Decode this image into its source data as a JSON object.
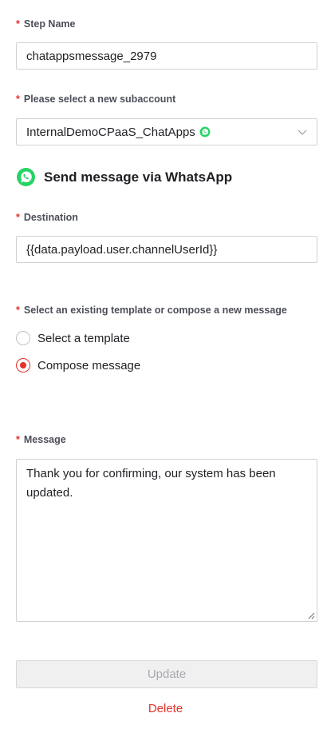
{
  "form": {
    "step_name": {
      "label": "Step Name",
      "value": "chatappsmessage_2979"
    },
    "subaccount": {
      "label": "Please select a new subaccount",
      "value": "InternalDemoCPaaS_ChatApps",
      "icon": "whatsapp-icon"
    },
    "section_heading": "Send message via WhatsApp",
    "destination": {
      "label": "Destination",
      "value": "{{data.payload.user.channelUserId}}"
    },
    "template_choice": {
      "label": "Select an existing template or compose a new message",
      "options": [
        "Select a template",
        "Compose message"
      ],
      "selected": "Compose message"
    },
    "message": {
      "label": "Message",
      "value": "Thank you for confirming, our system has been updated."
    },
    "update_label": "Update",
    "delete_label": "Delete",
    "required_marker": "*"
  },
  "colors": {
    "accent": "#e4322b",
    "whatsapp": "#25d366"
  }
}
